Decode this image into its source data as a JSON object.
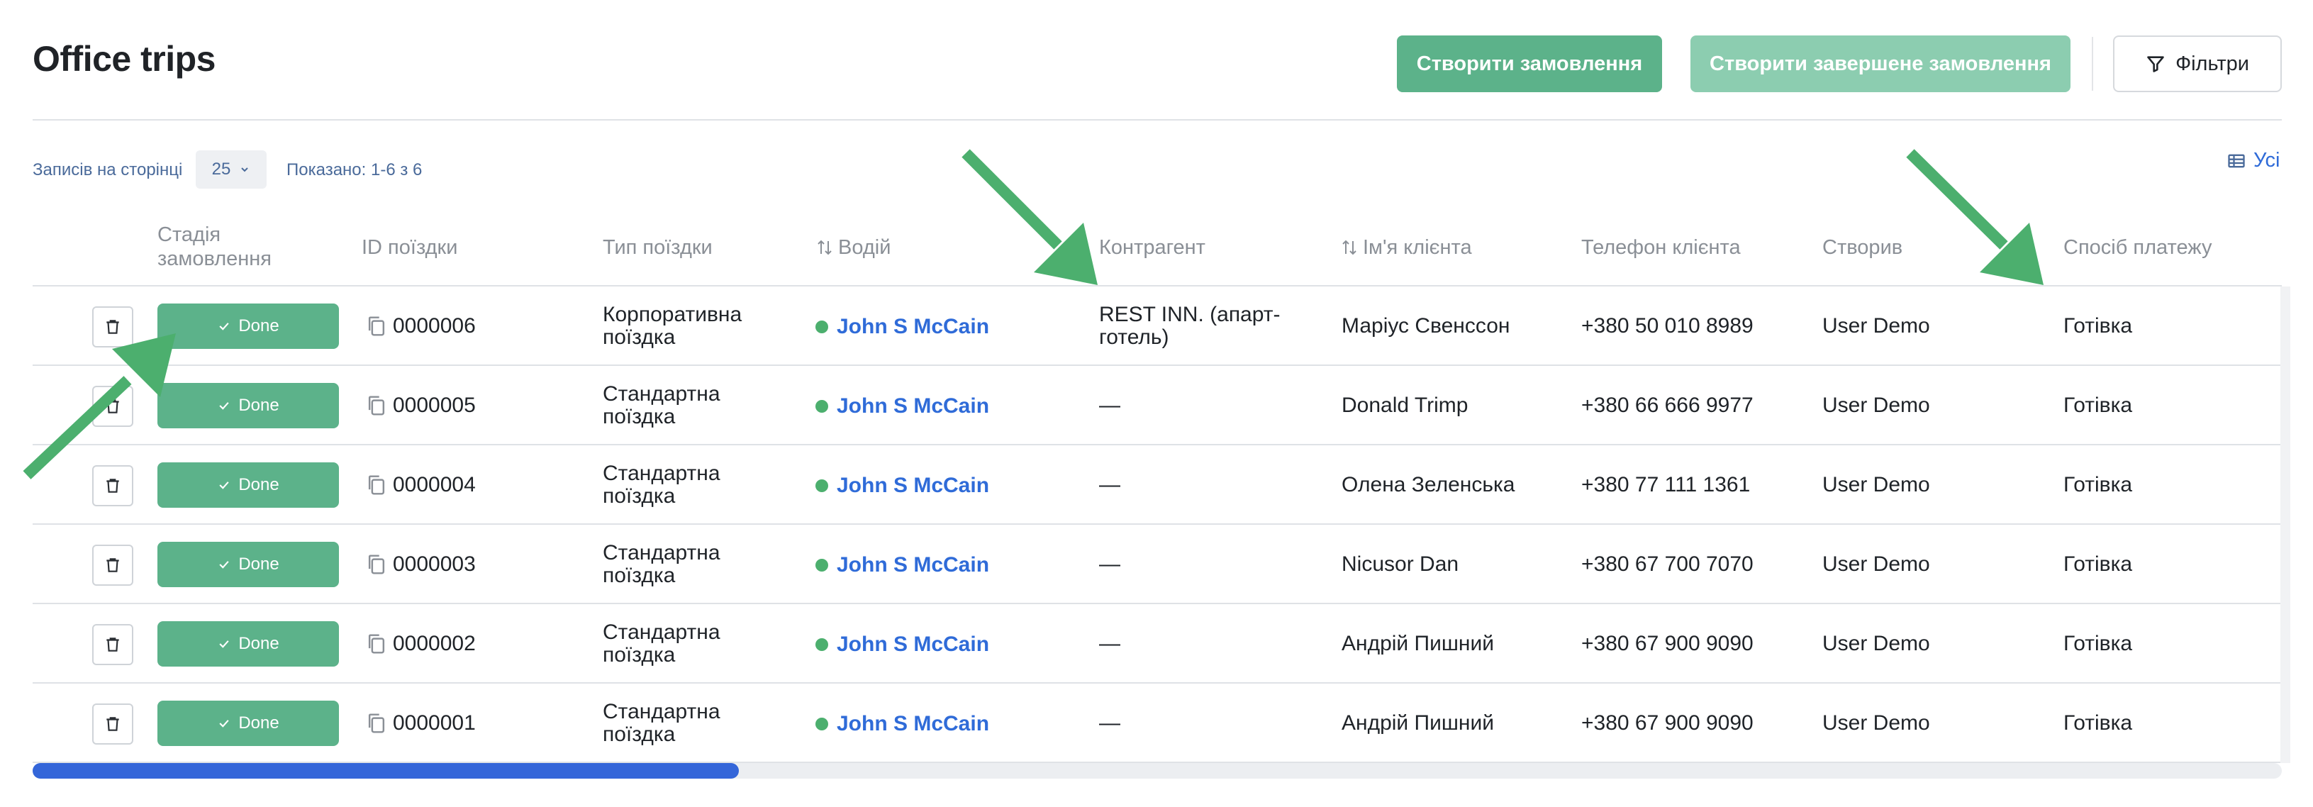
{
  "header": {
    "title": "Office trips",
    "create_order": "Створити замовлення",
    "create_completed_order": "Створити завершене замовлення",
    "filters": "Фільтри"
  },
  "toolbar": {
    "records_per_page_label": "Записів на сторінці",
    "records_per_page_value": "25",
    "shown": "Показано: 1-6 з 6",
    "columns_toggle": "Усі"
  },
  "columns": {
    "stage": "Стадія замовлення",
    "trip_id": "ID поїздки",
    "trip_type": "Тип поїздки",
    "driver": "Водій",
    "counterparty": "Контрагент",
    "client_name": "Ім'я клієнта",
    "client_phone": "Телефон клієнта",
    "created_by": "Створив",
    "payment": "Спосіб платежу"
  },
  "rows": [
    {
      "status": "Done",
      "id": "0000006",
      "type": "Корпоративна поїздка",
      "driver": "John S McCain",
      "counterparty": "REST INN. (апарт-готель)",
      "client": "Маріус Свенссон",
      "phone": "+380 50 010 8989",
      "created_by": "User Demo",
      "payment": "Готівка"
    },
    {
      "status": "Done",
      "id": "0000005",
      "type": "Стандартна поїздка",
      "driver": "John S McCain",
      "counterparty": "—",
      "client": "Donald Trimp",
      "phone": "+380 66 666 9977",
      "created_by": "User Demo",
      "payment": "Готівка"
    },
    {
      "status": "Done",
      "id": "0000004",
      "type": "Стандартна поїздка",
      "driver": "John S McCain",
      "counterparty": "—",
      "client": "Олена Зеленська",
      "phone": "+380 77 111 1361",
      "created_by": "User Demo",
      "payment": "Готівка"
    },
    {
      "status": "Done",
      "id": "0000003",
      "type": "Стандартна поїздка",
      "driver": "John S McCain",
      "counterparty": "—",
      "client": "Nicusor Dan",
      "phone": "+380 67 700 7070",
      "created_by": "User Demo",
      "payment": "Готівка"
    },
    {
      "status": "Done",
      "id": "0000002",
      "type": "Стандартна поїздка",
      "driver": "John S McCain",
      "counterparty": "—",
      "client": "Андрій Пишний",
      "phone": "+380 67 900 9090",
      "created_by": "User Demo",
      "payment": "Готівка"
    },
    {
      "status": "Done",
      "id": "0000001",
      "type": "Стандартна поїздка",
      "driver": "John S McCain",
      "counterparty": "—",
      "client": "Андрій Пишний",
      "phone": "+380 67 900 9090",
      "created_by": "User Demo",
      "payment": "Готівка"
    }
  ],
  "colors": {
    "accent_green": "#5cb28a",
    "link_blue": "#2f6bd8",
    "annotation_arrow": "#4caf6e"
  },
  "icons": [
    "filter-icon",
    "chevron-down-icon",
    "table-columns-icon",
    "sort-icon",
    "trash-icon",
    "check-icon",
    "copy-icon",
    "status-dot-icon",
    "annotation-arrow"
  ]
}
